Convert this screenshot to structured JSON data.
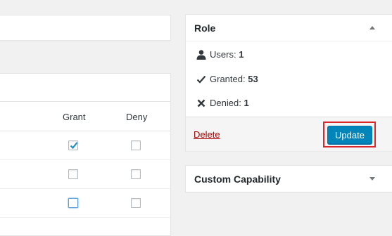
{
  "capability_table": {
    "columns": [
      "Grant",
      "Deny"
    ],
    "rows": [
      {
        "grant": true,
        "deny": false,
        "grant_focused": false
      },
      {
        "grant": false,
        "deny": false,
        "grant_focused": false
      },
      {
        "grant": false,
        "deny": false,
        "grant_focused": true
      }
    ]
  },
  "role_box": {
    "title": "Role",
    "users_label": "Users:",
    "users_value": "1",
    "granted_label": "Granted:",
    "granted_value": "53",
    "denied_label": "Denied:",
    "denied_value": "1",
    "delete_label": "Delete",
    "update_label": "Update",
    "highlight_color": "#d9272e",
    "accent_color": "#0085ba"
  },
  "custom_box": {
    "title": "Custom Capability"
  },
  "icons": {
    "users": "user-icon",
    "granted": "checkmark-icon",
    "denied": "x-icon"
  }
}
